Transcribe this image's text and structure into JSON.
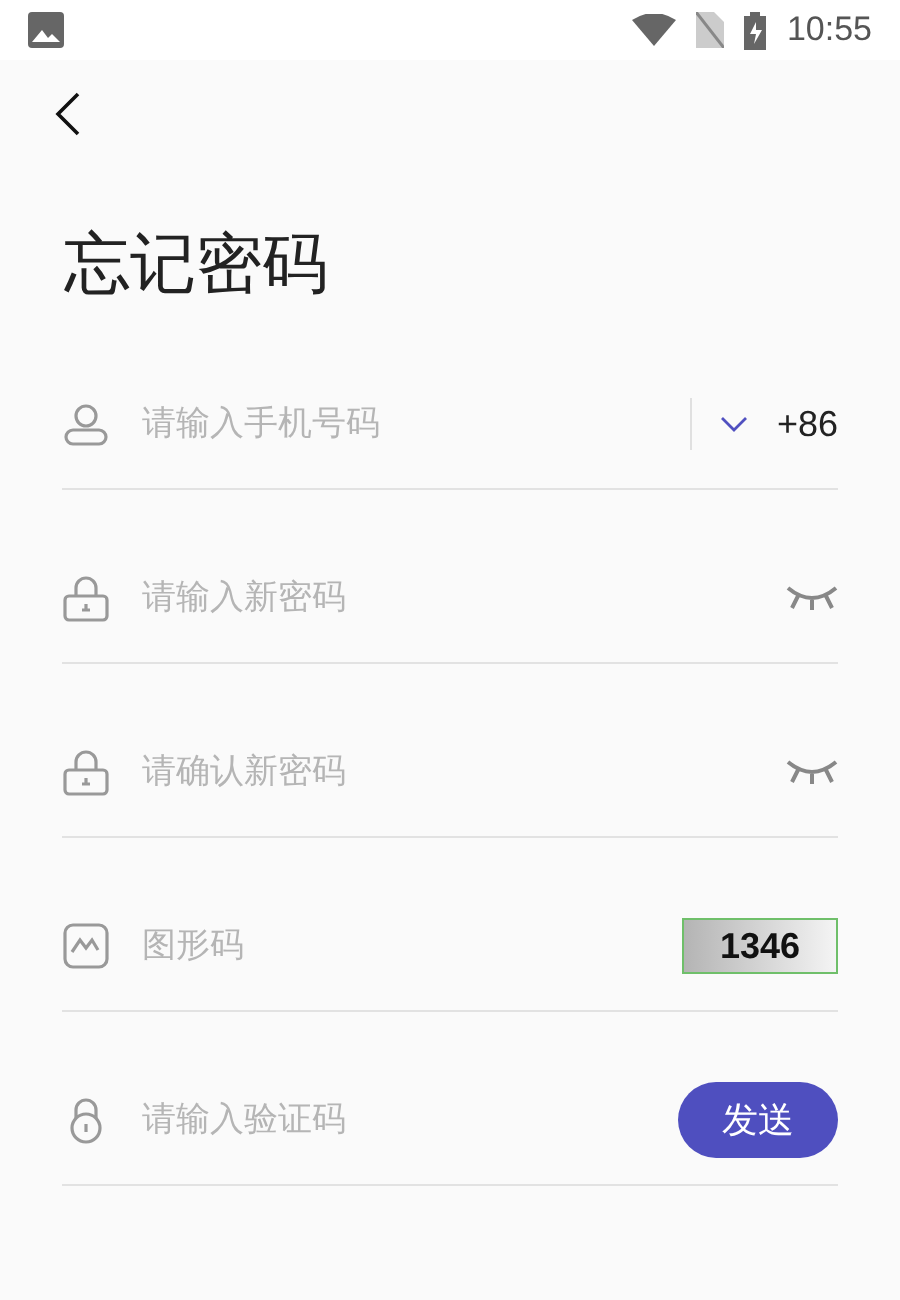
{
  "status_bar": {
    "time": "10:55"
  },
  "title": "忘记密码",
  "fields": [
    {
      "kind": "phone",
      "placeholder": "请输入手机号码",
      "country_code": "+86"
    },
    {
      "kind": "password",
      "placeholder": "请输入新密码"
    },
    {
      "kind": "password",
      "placeholder": "请确认新密码"
    },
    {
      "kind": "captcha",
      "placeholder": "图形码",
      "captcha": "1346"
    },
    {
      "kind": "code",
      "placeholder": "请输入验证码",
      "button": "发送"
    }
  ]
}
